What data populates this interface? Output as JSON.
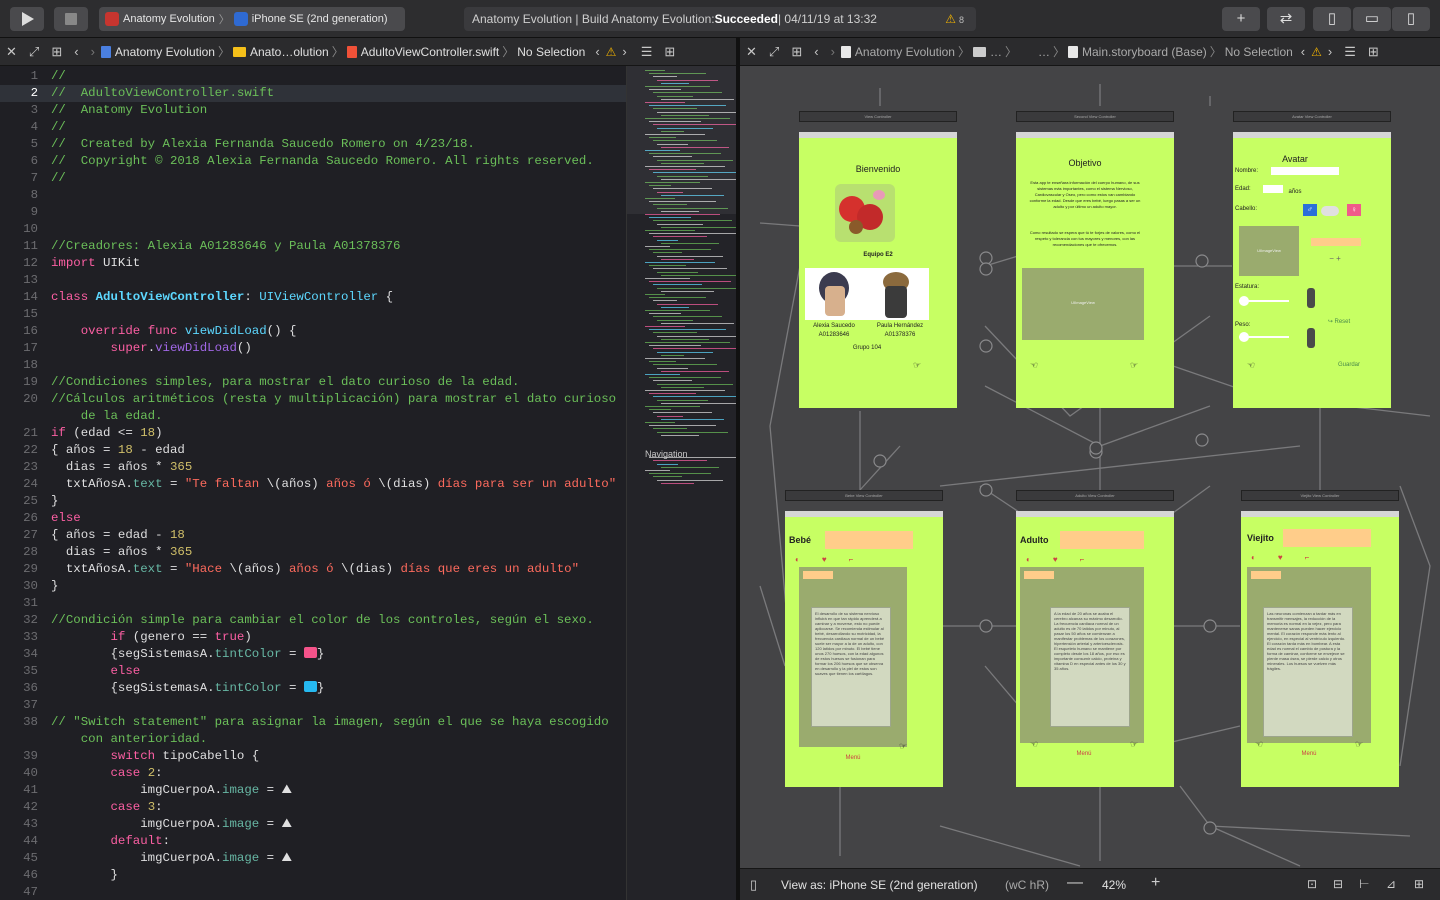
{
  "toolbar": {
    "scheme_app": "Anatomy Evolution",
    "scheme_device": "iPhone SE (2nd generation)",
    "activity_prefix": "Anatomy Evolution | Build Anatomy Evolution: ",
    "activity_status": "Succeeded",
    "activity_time": " | 04/11/19 at 13:32",
    "warning_count": "8"
  },
  "editor_jumpbar": {
    "project": "Anatomy Evolution",
    "group": "Anato…olution",
    "file": "AdultoViewController.swift",
    "selection": "No Selection"
  },
  "canvas_jumpbar": {
    "project": "Anatomy Evolution",
    "group": "…",
    "ellipsis": "…",
    "file": "Main.storyboard (Base)",
    "selection": "No Selection"
  },
  "minimap": {
    "label": "Navigation"
  },
  "code_lines": [
    {
      "n": "1",
      "tokens": [
        [
          "c",
          "//"
        ]
      ]
    },
    {
      "n": "2",
      "tokens": [
        [
          "c",
          "//  AdultoViewController.swift"
        ]
      ]
    },
    {
      "n": "3",
      "tokens": [
        [
          "c",
          "//  Anatomy Evolution"
        ]
      ]
    },
    {
      "n": "4",
      "tokens": [
        [
          "c",
          "//"
        ]
      ]
    },
    {
      "n": "5",
      "tokens": [
        [
          "c",
          "//  Created by Alexia Fernanda Saucedo Romero on 4/23/18."
        ]
      ]
    },
    {
      "n": "6",
      "tokens": [
        [
          "c",
          "//  Copyright © 2018 Alexia Fernanda Saucedo Romero. All rights reserved."
        ]
      ]
    },
    {
      "n": "7",
      "tokens": [
        [
          "c",
          "//"
        ]
      ]
    },
    {
      "n": "8",
      "tokens": []
    },
    {
      "n": "9",
      "tokens": []
    },
    {
      "n": "10",
      "tokens": []
    },
    {
      "n": "11",
      "tokens": [
        [
          "c",
          "//Creadores: Alexia A01283646 y Paula A01378376"
        ]
      ]
    },
    {
      "n": "12",
      "tokens": [
        [
          "k",
          "import"
        ],
        [
          "",
          " UIKit"
        ]
      ]
    },
    {
      "n": "13",
      "tokens": []
    },
    {
      "n": "14",
      "tokens": [
        [
          "k",
          "class"
        ],
        [
          "",
          " "
        ],
        [
          "cls",
          "AdultoViewController"
        ],
        [
          "",
          ": "
        ],
        [
          "t",
          "UIViewController"
        ],
        [
          "",
          " {"
        ]
      ]
    },
    {
      "n": "15",
      "tokens": []
    },
    {
      "n": "16",
      "tokens": [
        [
          "",
          "    "
        ],
        [
          "k",
          "override"
        ],
        [
          "",
          " "
        ],
        [
          "k",
          "func"
        ],
        [
          "",
          " "
        ],
        [
          "t",
          "viewDidLoad"
        ],
        [
          "",
          "() {"
        ]
      ]
    },
    {
      "n": "17",
      "tokens": [
        [
          "",
          "        "
        ],
        [
          "k",
          "super"
        ],
        [
          "",
          "."
        ],
        [
          "f",
          "viewDidLoad"
        ],
        [
          "",
          "()"
        ]
      ]
    },
    {
      "n": "18",
      "tokens": []
    },
    {
      "n": "19",
      "tokens": [
        [
          "c",
          "//Condiciones simples, para mostrar el dato curioso de la edad."
        ]
      ]
    },
    {
      "n": "20",
      "tokens": [
        [
          "c",
          "//Cálculos aritméticos (resta y multiplicación) para mostrar el dato curioso"
        ]
      ]
    },
    {
      "n": "",
      "tokens": [
        [
          "c",
          "    de la edad."
        ]
      ]
    },
    {
      "n": "21",
      "tokens": [
        [
          "k",
          "if"
        ],
        [
          "",
          " (edad <= "
        ],
        [
          "n",
          "18"
        ],
        [
          "",
          ")"
        ]
      ]
    },
    {
      "n": "22",
      "tokens": [
        [
          "",
          "{ años = "
        ],
        [
          "n",
          "18"
        ],
        [
          "",
          " - edad"
        ]
      ]
    },
    {
      "n": "23",
      "tokens": [
        [
          "",
          "  dias = años * "
        ],
        [
          "n",
          "365"
        ]
      ]
    },
    {
      "n": "24",
      "tokens": [
        [
          "",
          "  txtAñosA."
        ],
        [
          "prop",
          "text"
        ],
        [
          "",
          " = "
        ],
        [
          "s",
          "\"Te faltan "
        ],
        [
          "",
          "\\(años)"
        ],
        [
          "s",
          " años ó "
        ],
        [
          "",
          "\\(dias)"
        ],
        [
          "s",
          " días para ser un adulto\""
        ]
      ]
    },
    {
      "n": "25",
      "tokens": [
        [
          "",
          "}"
        ]
      ]
    },
    {
      "n": "26",
      "tokens": [
        [
          "k",
          "else"
        ]
      ]
    },
    {
      "n": "27",
      "tokens": [
        [
          "",
          "{ años = edad - "
        ],
        [
          "n",
          "18"
        ]
      ]
    },
    {
      "n": "28",
      "tokens": [
        [
          "",
          "  dias = años * "
        ],
        [
          "n",
          "365"
        ]
      ]
    },
    {
      "n": "29",
      "tokens": [
        [
          "",
          "  txtAñosA."
        ],
        [
          "prop",
          "text"
        ],
        [
          "",
          " = "
        ],
        [
          "s",
          "\"Hace "
        ],
        [
          "",
          "\\(años)"
        ],
        [
          "s",
          " años ó "
        ],
        [
          "",
          "\\(dias)"
        ],
        [
          "s",
          " días que eres un adulto\""
        ]
      ]
    },
    {
      "n": "30",
      "tokens": [
        [
          "",
          "}"
        ]
      ]
    },
    {
      "n": "31",
      "tokens": []
    },
    {
      "n": "32",
      "tokens": [
        [
          "c",
          "//Condición simple para cambiar el color de los controles, según el sexo."
        ]
      ]
    },
    {
      "n": "33",
      "tokens": [
        [
          "",
          "        "
        ],
        [
          "k",
          "if"
        ],
        [
          "",
          " (genero == "
        ],
        [
          "k",
          "true"
        ],
        [
          "",
          ")"
        ]
      ]
    },
    {
      "n": "34",
      "tokens": [
        [
          "",
          "        {segSistemasA."
        ],
        [
          "prop",
          "tintColor"
        ],
        [
          "",
          " = "
        ],
        [
          "sw-pink",
          ""
        ],
        [
          "",
          "}"
        ]
      ]
    },
    {
      "n": "35",
      "tokens": [
        [
          "",
          "        "
        ],
        [
          "k",
          "else"
        ]
      ]
    },
    {
      "n": "36",
      "tokens": [
        [
          "",
          "        {segSistemasA."
        ],
        [
          "prop",
          "tintColor"
        ],
        [
          "",
          " = "
        ],
        [
          "sw-blue",
          ""
        ],
        [
          "",
          "}"
        ]
      ]
    },
    {
      "n": "37",
      "tokens": []
    },
    {
      "n": "38",
      "tokens": [
        [
          "c",
          "// \"Switch statement\" para asignar la imagen, según el que se haya escogido"
        ]
      ]
    },
    {
      "n": "",
      "tokens": [
        [
          "c",
          "    con anterioridad."
        ]
      ]
    },
    {
      "n": "39",
      "tokens": [
        [
          "",
          "        "
        ],
        [
          "k",
          "switch"
        ],
        [
          "",
          " tipoCabello {"
        ]
      ]
    },
    {
      "n": "40",
      "tokens": [
        [
          "",
          "        "
        ],
        [
          "k",
          "case"
        ],
        [
          "",
          " "
        ],
        [
          "n",
          "2"
        ],
        [
          "",
          ":"
        ]
      ]
    },
    {
      "n": "41",
      "tokens": [
        [
          "",
          "            imgCuerpoA."
        ],
        [
          "prop",
          "image"
        ],
        [
          "",
          " = "
        ],
        [
          "",
          "⛰"
        ]
      ]
    },
    {
      "n": "42",
      "tokens": [
        [
          "",
          "        "
        ],
        [
          "k",
          "case"
        ],
        [
          "",
          " "
        ],
        [
          "n",
          "3"
        ],
        [
          "",
          ":"
        ]
      ]
    },
    {
      "n": "43",
      "tokens": [
        [
          "",
          "            imgCuerpoA."
        ],
        [
          "prop",
          "image"
        ],
        [
          "",
          " = "
        ],
        [
          "",
          "⛰"
        ]
      ]
    },
    {
      "n": "44",
      "tokens": [
        [
          "",
          "        "
        ],
        [
          "k",
          "default"
        ],
        [
          "",
          ":"
        ]
      ]
    },
    {
      "n": "45",
      "tokens": [
        [
          "",
          "            imgCuerpoA."
        ],
        [
          "prop",
          "image"
        ],
        [
          "",
          " = "
        ],
        [
          "",
          "⛰"
        ]
      ]
    },
    {
      "n": "46",
      "tokens": [
        [
          "",
          "        }"
        ]
      ]
    },
    {
      "n": "47",
      "tokens": []
    }
  ],
  "storyboard": {
    "scenes": [
      {
        "title": "View Controller"
      },
      {
        "title": "Second View Controller"
      },
      {
        "title": "Avatar View Controller"
      },
      {
        "title": "Bebe View Controller"
      },
      {
        "title": "Adulto View Controller"
      },
      {
        "title": "Viejito View Controller"
      }
    ],
    "welcome": {
      "heading": "Bienvenido",
      "team": "Equipo E2",
      "member1_name": "Alexia Saucedo",
      "member1_id": "A01283646",
      "member2_name": "Paula Hernández",
      "member2_id": "A01378376",
      "group": "Grupo 104"
    },
    "objetivo": {
      "heading": "Objetivo",
      "paragraph1": "Esta app te enseñara información del cuerpo humano, de sus sistemas más importantes, como el sistema Nervioso, Cardiovascular y Oseo, pero como estos van cambiando conforme la edad. Desde que eres bebé, luego pasas a ser un adulto y por último un adulto mayor.",
      "paragraph2": "Como resultado se espera que tú te forjes de valores, como el respeto y tolerancia con tus mayores y menores, con las recomendaciones que te ofrecemos.",
      "image_placeholder": "UIImageView"
    },
    "avatar": {
      "heading": "Avatar",
      "name_label": "Nombre:",
      "age_label": "Edad:",
      "age_unit": "años",
      "hair_label": "Cabello:",
      "image_placeholder": "UIImageView",
      "height_label": "Estatura:",
      "weight_label": "Peso:",
      "reset": "↪ Reset",
      "save": "Guardar"
    },
    "bebe": {
      "heading": "Bebé",
      "note": "El desarrollo de su sistema nervioso influirá en que tan rápido aprenderá a caminar y a moverse, esto no puede apliccarse. Se recomienda estimular al bebé, desarrollando su motricidad, la frecuencia cardiaca normal de un bebé suele ser mayor a la de un adulto, con 120 latidos por minuto. El bebé tiene unos 270 huesos, con la edad algunos de estos huesos se fusionan para formar los 206 huesos que se observa en desarrollo y la piel de estos son suaves que tienen los cartílagos.",
      "prev": "Menú"
    },
    "adulto": {
      "heading": "Adulto",
      "note": "A la edad de 20 años se acaba el cerebro alcanza su máximo desarrollo. La frecuencia cardiaca normal de un adulto es de 70 latidos por minuto, al pasar los 50 años se comienzan a manifestar problemas de los corazones, hipertensión arterial y arterioesclerosis. El esqueleto humano se mantiene por completo desde los 18 años, por eso es importante consumir calcio, proteína y vitamina D en especial antes de los 30 y 35 años.",
      "prev": "Menú"
    },
    "viejito": {
      "heading": "Viejito",
      "note": "Las neuronas comienzan a tardar más en transmitir mensajes, la reducción de la memoria es normal en la vejez, pero para mantenerse sanas pueden hacer ejercicio mental. El corazón responde más lento al ejercicio, en especial al ventrículo izquierdo. El corazón tarda más en bombear. A esta edad es normal el cambio de postura y la forma de caminar, conforme se envejece se pierde masa ósea, se pierde calcio y otros minerales. Los huesos se vuelven más frágiles.",
      "prev": "Menú"
    }
  },
  "bottom_bar": {
    "view_as": "View as: iPhone SE (2nd generation)",
    "traits": "(wC hR)",
    "zoom": "42%"
  },
  "colors": {
    "scene_background": "#c7ff63",
    "canvas": "#444446",
    "editor_background": "#1f1f24",
    "comment": "#6bbf59",
    "keyword": "#fc5fa3",
    "string": "#fc6a5d",
    "type": "#5dd8ff"
  }
}
